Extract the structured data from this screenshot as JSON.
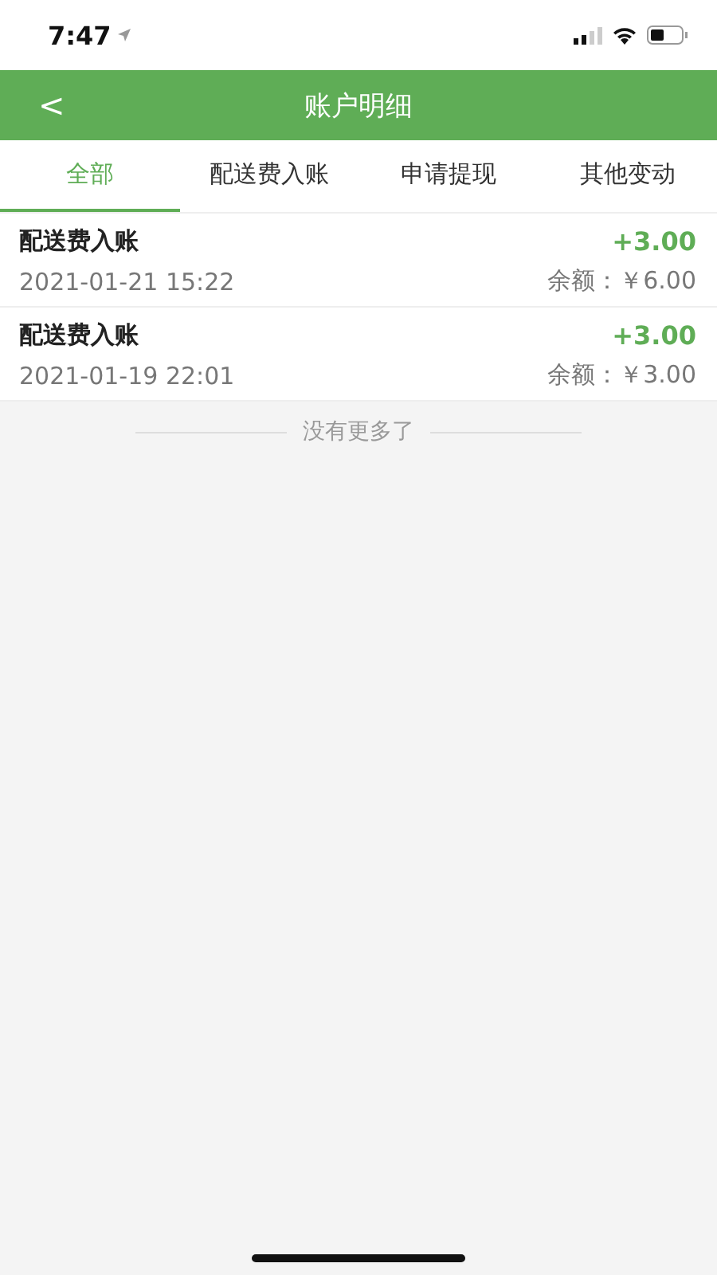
{
  "status_bar": {
    "time": "7:47"
  },
  "header": {
    "back": "<",
    "title": "账户明细"
  },
  "tabs": [
    {
      "label": "全部",
      "selected": true
    },
    {
      "label": "配送费入账",
      "selected": false
    },
    {
      "label": "申请提现",
      "selected": false
    },
    {
      "label": "其他变动",
      "selected": false
    }
  ],
  "records": [
    {
      "title": "配送费入账",
      "amount": "+3.00",
      "time": "2021-01-21 15:22",
      "balance": "余额：￥6.00"
    },
    {
      "title": "配送费入账",
      "amount": "+3.00",
      "time": "2021-01-19 22:01",
      "balance": "余额：￥3.00"
    }
  ],
  "end_note": "没有更多了"
}
